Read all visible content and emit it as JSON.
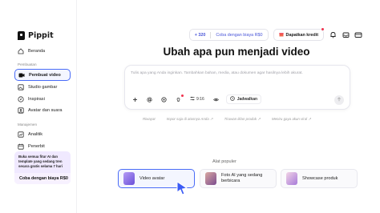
{
  "app": {
    "name": "Pippit"
  },
  "colors": {
    "accent": "#4a6cf7",
    "badge": "#f0334e",
    "promo_bg": "#f0e9ff"
  },
  "sidebar": {
    "top_items": [
      {
        "label": "Beranda",
        "icon": "home-icon"
      }
    ],
    "sections": [
      {
        "label": "Pembuatan",
        "items": [
          {
            "label": "Pembuat video",
            "icon": "video-camera-icon",
            "active": true
          },
          {
            "label": "Studio gambar",
            "icon": "image-icon"
          },
          {
            "label": "Inspirasi",
            "icon": "compass-icon"
          },
          {
            "label": "Avatar dan suara",
            "icon": "avatar-icon"
          }
        ]
      },
      {
        "label": "Manajemen",
        "items": [
          {
            "label": "Analitik",
            "icon": "chart-icon"
          },
          {
            "label": "Penerbit",
            "icon": "calendar-icon"
          }
        ]
      }
    ],
    "promo": {
      "text": "Buka semua fitur AI dan template yang sedang tren secara gratis selama 7 hari",
      "button": "Coba dengan biaya R$0"
    }
  },
  "topbar": {
    "credits": "320",
    "credit_prefix": "+",
    "try_label": "Coba dengan biaya R$0",
    "buy_label": "Dapatkan kredit",
    "icons": [
      "bell-icon",
      "inbox-icon",
      "wallet-icon"
    ]
  },
  "main": {
    "title": "Ubah apa pun menjadi video",
    "prompt_placeholder": "Tulis apa yang Anda inginkan. Tambahkan bahan, media, atau dokumen agar hasilnya lebih akurat.",
    "tools": {
      "ratio_label": "9:16",
      "schedule_label": "Jadwalkan"
    },
    "suggestions": [
      "Riwayat",
      "Impor saja di atasnya Anda ↗",
      "Tiruwan iklan produk ↗",
      "Meniru gaya akun viral ↗"
    ],
    "popular": {
      "title": "Alat populer",
      "tools": [
        {
          "label": "Video avatar",
          "active": true
        },
        {
          "label": "Foto AI yang sedang berbicara"
        },
        {
          "label": "Showcase produk"
        }
      ]
    }
  }
}
